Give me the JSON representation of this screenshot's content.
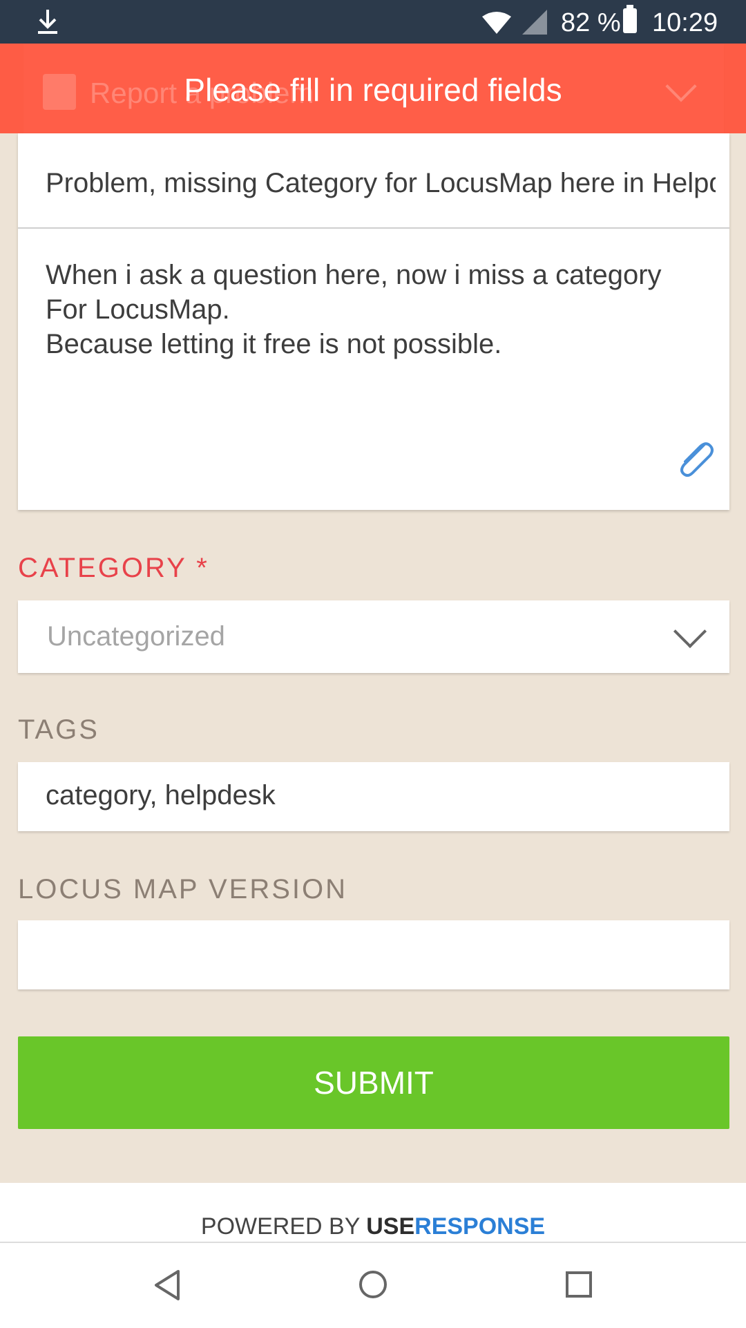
{
  "status_bar": {
    "battery_percent": "82 %",
    "time": "10:29",
    "icons": [
      "download-icon",
      "wifi-icon",
      "cell-signal-icon",
      "battery-icon"
    ]
  },
  "header": {
    "title": "Report a problem",
    "icon": "alert-icon"
  },
  "toast": {
    "message": "Please fill in required fields",
    "color": "#ff523a"
  },
  "form": {
    "title_value": "Problem, missing Category for LocusMap here in Helpdesk",
    "description_lines": [
      "When i ask a question here, now i miss a category",
      "For LocusMap.",
      "Because letting it free is not possible."
    ],
    "category": {
      "label": "CATEGORY",
      "required_mark": "*",
      "selected": "Uncategorized"
    },
    "tags": {
      "label": "TAGS",
      "value": "category, helpdesk"
    },
    "version": {
      "label": "LOCUS MAP VERSION",
      "value": ""
    },
    "submit_label": "SUBMIT"
  },
  "footer": {
    "powered_by": "POWERED BY",
    "brand_part1": "USE",
    "brand_part2": "RESPONSE"
  },
  "colors": {
    "accent_green": "#69c629",
    "error_red": "#e8424a",
    "brand_blue": "#2b7fd6",
    "background": "#ede3d6"
  }
}
